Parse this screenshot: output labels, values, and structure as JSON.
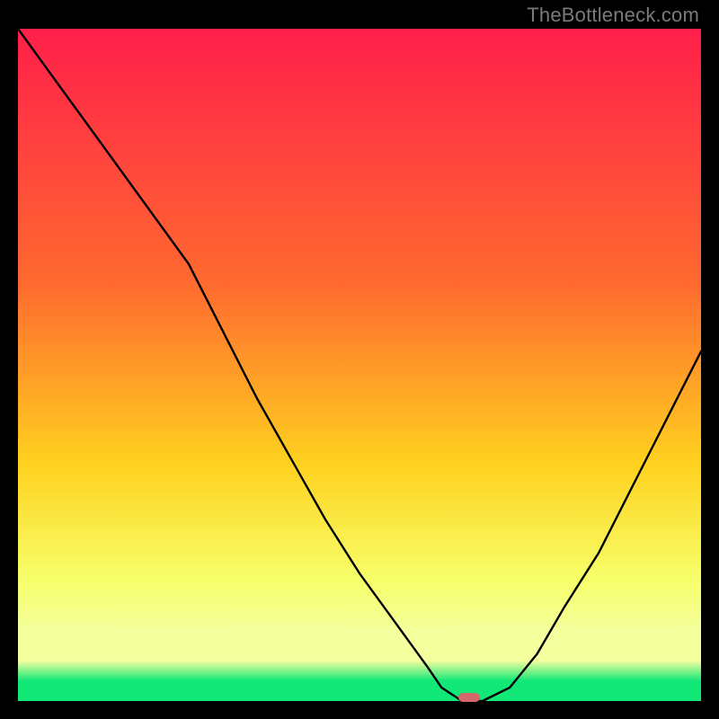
{
  "watermark": "TheBottleneck.com",
  "colors": {
    "frame": "#000000",
    "gradient_top": "#ff1f4b",
    "gradient_upper_mid": "#ff6a2f",
    "gradient_mid": "#ffd21f",
    "gradient_lower_mid": "#f6ff6a",
    "gradient_band": "#f4ff9e",
    "gradient_green": "#12e878",
    "curve": "#000000",
    "marker": "#d4676c"
  },
  "chart_data": {
    "type": "line",
    "title": "",
    "xlabel": "",
    "ylabel": "",
    "xlim": [
      0,
      100
    ],
    "ylim": [
      0,
      100
    ],
    "series": [
      {
        "name": "curve",
        "x": [
          0,
          5,
          10,
          15,
          20,
          25,
          30,
          35,
          40,
          45,
          50,
          55,
          60,
          62,
          65,
          68,
          72,
          76,
          80,
          85,
          90,
          95,
          100
        ],
        "y": [
          100,
          93,
          86,
          79,
          72,
          65,
          55,
          45,
          36,
          27,
          19,
          12,
          5,
          2,
          0,
          0,
          2,
          7,
          14,
          22,
          32,
          42,
          52
        ]
      }
    ],
    "marker": {
      "x": 66,
      "y": 0
    },
    "gradient_stops_pct": [
      0,
      38,
      65,
      82,
      90,
      94,
      97,
      100
    ]
  }
}
